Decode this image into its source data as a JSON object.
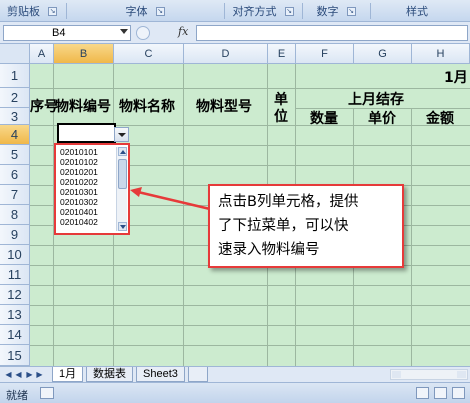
{
  "ribbon": {
    "groups": [
      {
        "label": "剪贴板"
      },
      {
        "label": "字体"
      },
      {
        "label": "对齐方式"
      },
      {
        "label": "数字"
      },
      {
        "label": "样式"
      }
    ],
    "launcher_icon": "dialog-launcher-icon"
  },
  "formula_bar": {
    "name_box": "B4",
    "fx_label": "fx",
    "value": ""
  },
  "columns": [
    "A",
    "B",
    "C",
    "D",
    "E",
    "F",
    "G",
    "H"
  ],
  "rows": [
    "1",
    "2",
    "3",
    "4",
    "5",
    "6",
    "7",
    "8",
    "9",
    "10",
    "11",
    "12",
    "13",
    "14",
    "15"
  ],
  "selected": {
    "column": "B",
    "row": "4"
  },
  "sheet": {
    "month_title": "1月",
    "headers": {
      "seq": "序号",
      "item_code": "物料编号",
      "item_name": "物料名称",
      "item_model": "物料型号",
      "unit_1": "单",
      "unit_2": "位",
      "last_balance": "上月结存",
      "qty": "数量",
      "price": "单价",
      "amount": "金额"
    }
  },
  "dropdown": {
    "items": [
      "02010101",
      "02010102",
      "02010201",
      "02010202",
      "02010301",
      "02010302",
      "02010401",
      "02010402"
    ]
  },
  "callout": {
    "line1": "点击B列单元格，提供",
    "line2": "了下拉菜单，可以快",
    "line3": "速录入物料编号"
  },
  "tabs": [
    {
      "label": "1月",
      "active": true
    },
    {
      "label": "数据表",
      "active": false
    },
    {
      "label": "Sheet3",
      "active": false
    }
  ],
  "status": {
    "ready": "就绪"
  },
  "colors": {
    "sheet_fill": "#ccebcf",
    "callout_border": "#e63a3a",
    "grid_line": "#9cb7a0"
  }
}
